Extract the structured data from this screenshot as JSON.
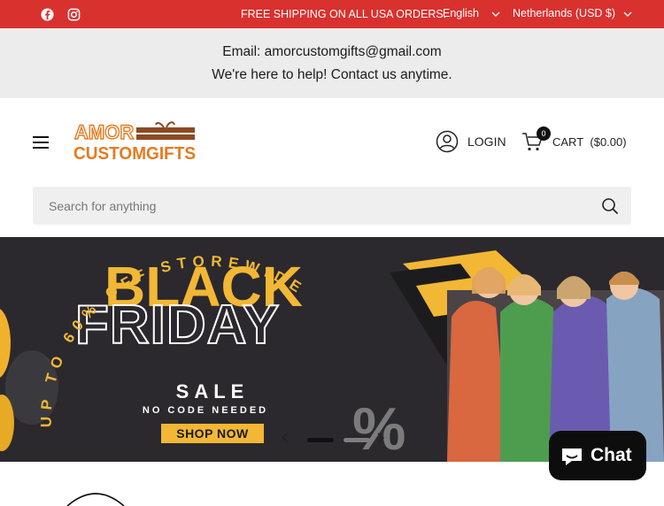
{
  "topbar": {
    "shipping": "FREE SHIPPING ON ALL USA ORDERS.",
    "language": "English",
    "currency": "Netherlands (USD $)",
    "bg_color": "#d9312e"
  },
  "notice": {
    "email": "Email: amorcustomgifts@gmail.com",
    "help": "We're here to help! Contact us anytime."
  },
  "header": {
    "logo_line1": "AMOR",
    "logo_line2": "CUSTOMGIFTS",
    "login": "LOGIN",
    "cart_count": "0",
    "cart_label": "CART",
    "cart_total": "($0.00)",
    "search_placeholder": "Search for anything"
  },
  "hero": {
    "black": "BLACK",
    "friday": "FRIDAY",
    "arc_text": "UP TO 60% OFF STOREWIDE",
    "sale": "SALE",
    "no_code": "NO CODE NEEDED",
    "shop_now": "SHOP NOW",
    "percent": "%",
    "accent": "#f2b735"
  },
  "chat": {
    "label": "Chat"
  }
}
